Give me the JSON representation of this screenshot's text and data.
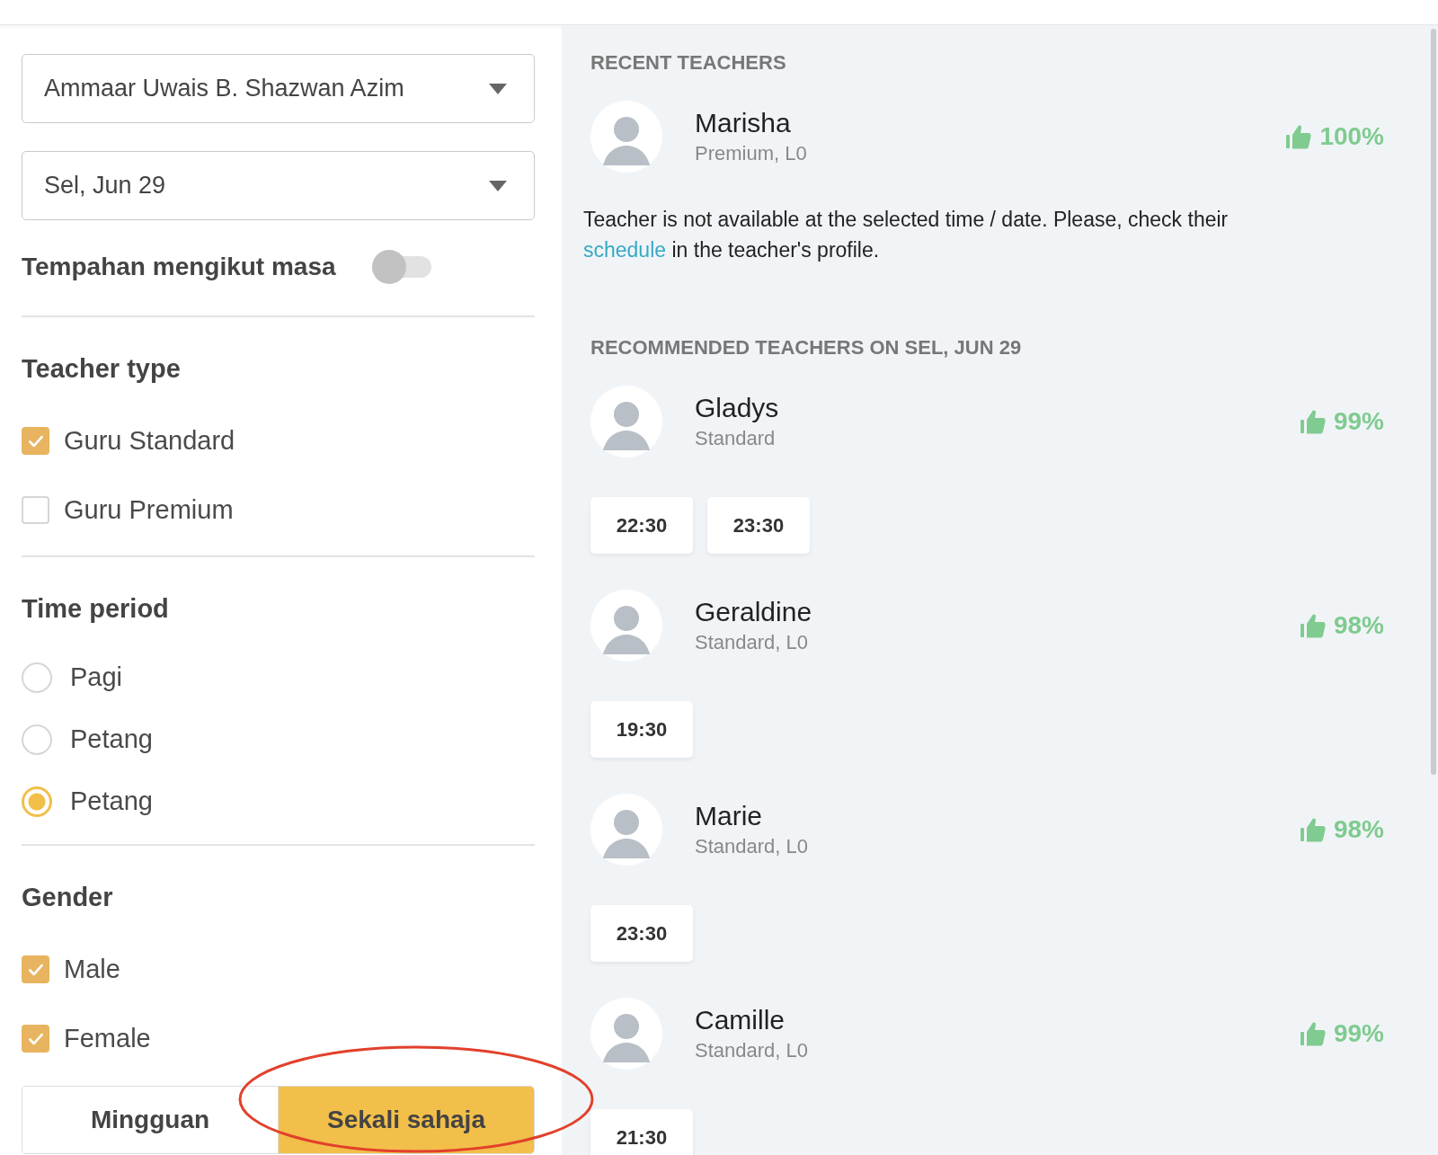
{
  "filters": {
    "student": {
      "value": "Ammaar Uwais B. Shazwan Azim"
    },
    "date": {
      "value": "Sel, Jun 29"
    },
    "time_booking": {
      "label": "Tempahan mengikut masa",
      "on": false
    },
    "teacher_type": {
      "title": "Teacher type",
      "options": [
        {
          "label": "Guru Standard",
          "checked": true
        },
        {
          "label": "Guru Premium",
          "checked": false
        }
      ]
    },
    "time_period": {
      "title": "Time period",
      "options": [
        {
          "label": "Pagi",
          "selected": false
        },
        {
          "label": "Petang",
          "selected": false
        },
        {
          "label": "Petang",
          "selected": true
        }
      ]
    },
    "gender": {
      "title": "Gender",
      "options": [
        {
          "label": "Male",
          "checked": true
        },
        {
          "label": "Female",
          "checked": true
        }
      ]
    },
    "frequency": [
      {
        "label": "Mingguan",
        "selected": false
      },
      {
        "label": "Sekali sahaja",
        "selected": true
      }
    ]
  },
  "recent": {
    "title": "RECENT TEACHERS",
    "teachers": [
      {
        "name": "Marisha",
        "subtitle": "Premium, L0",
        "rating": "100%"
      }
    ],
    "message": {
      "before": "Teacher is not available at the selected time / date. Please, check their",
      "link": "schedule",
      "after": "in the teacher's profile."
    }
  },
  "recommended": {
    "title": "RECOMMENDED TEACHERS ON SEL, JUN 29",
    "teachers": [
      {
        "name": "Gladys",
        "subtitle": "Standard",
        "rating": "99%",
        "times": [
          "22:30",
          "23:30"
        ]
      },
      {
        "name": "Geraldine",
        "subtitle": "Standard, L0",
        "rating": "98%",
        "times": [
          "19:30"
        ]
      },
      {
        "name": "Marie",
        "subtitle": "Standard, L0",
        "rating": "98%",
        "times": [
          "23:30"
        ]
      },
      {
        "name": "Camille",
        "subtitle": "Standard, L0",
        "rating": "99%",
        "times": [
          "21:30"
        ]
      }
    ]
  }
}
